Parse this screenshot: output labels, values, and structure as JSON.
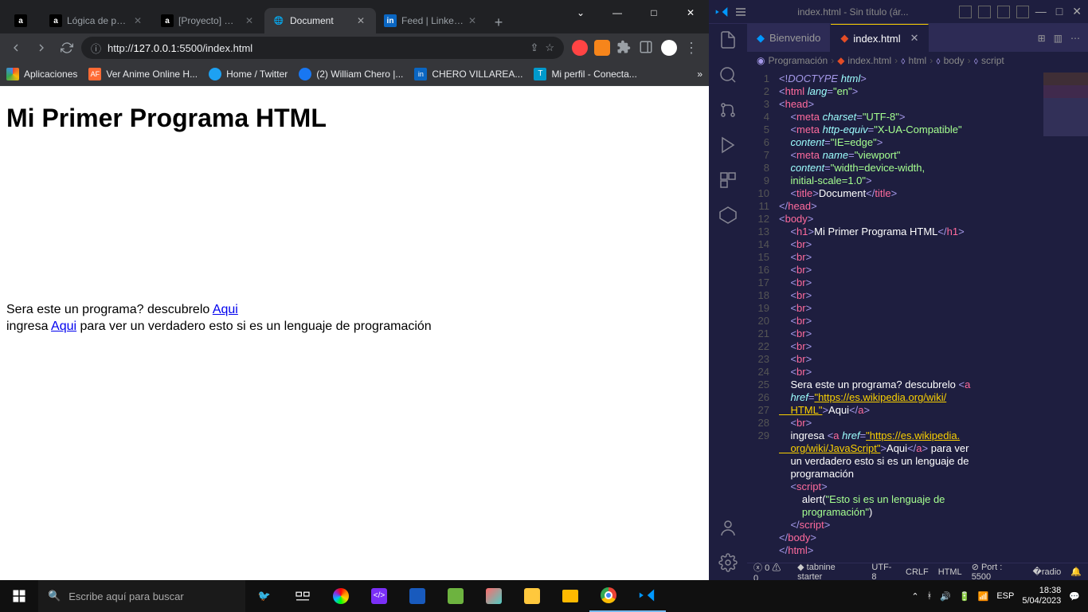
{
  "chrome": {
    "tabs": [
      {
        "title": "",
        "favicon": "a",
        "fav_bg": "#000"
      },
      {
        "title": "Lógica de prog",
        "favicon": "a",
        "fav_bg": "#000"
      },
      {
        "title": "[Proyecto] Haz",
        "favicon": "a",
        "fav_bg": "#000"
      },
      {
        "title": "Document",
        "favicon": "🌐",
        "fav_bg": "transparent",
        "active": true
      },
      {
        "title": "Feed | LinkedIn",
        "favicon": "in",
        "fav_bg": "#0a66c2"
      }
    ],
    "url": {
      "prefix": "http://",
      "host": "127.0.0.1",
      "path": ":5500/index.html"
    },
    "bookmarks": [
      {
        "label": "Aplicaciones",
        "color": "#4285f4"
      },
      {
        "label": "Ver Anime Online H...",
        "color": "#ff6b35",
        "prefix": "AF"
      },
      {
        "label": "Home / Twitter",
        "color": "#1da1f2"
      },
      {
        "label": "(2) William Chero |...",
        "color": "#1877f2"
      },
      {
        "label": "CHERO VILLAREA...",
        "color": "#0a66c2",
        "prefix": "in"
      },
      {
        "label": "Mi perfil - Conecta...",
        "color": "#0099cc",
        "prefix": "T"
      }
    ]
  },
  "page": {
    "h1": "Mi Primer Programa HTML",
    "line1_a": "Sera este un programa? descubrelo ",
    "line1_link": "Aqui",
    "line2_a": "ingresa ",
    "line2_link": "Aqui",
    "line2_b": " para ver un verdadero esto si es un lenguaje de programación"
  },
  "vscode": {
    "title": "index.html - Sin título (ár...",
    "tab_welcome": "Bienvenido",
    "tab_file": "index.html",
    "breadcrumb": [
      "Programación",
      "index.html",
      "html",
      "body",
      "script"
    ],
    "status": {
      "errors": "0",
      "warnings": "0",
      "tabnine": "tabnine starter",
      "encoding": "UTF-8",
      "eol": "CRLF",
      "lang": "HTML",
      "port": "Port : 5500"
    },
    "gutter": [
      "1",
      "2",
      "3",
      "4",
      "5",
      "6",
      "7",
      "8",
      "9",
      "10",
      "11",
      "12",
      "13",
      "14",
      "15",
      "16",
      "17",
      "18",
      "19",
      "20",
      "21",
      "22",
      "23",
      "24",
      "25",
      "26",
      "27",
      "28",
      "29"
    ]
  },
  "taskbar": {
    "search_placeholder": "Escribe aquí para buscar",
    "lang": "ESP",
    "time": "18:38",
    "date": "5/04/2023"
  }
}
